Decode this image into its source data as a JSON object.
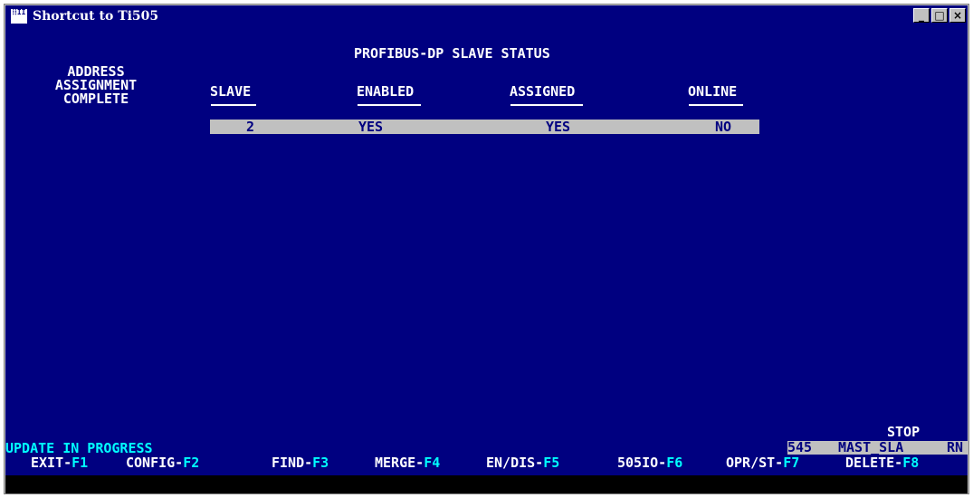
{
  "window": {
    "title": "Shortcut to Ti505",
    "icon_text": "⁞⁞ΙΙ",
    "minimize": "_",
    "maximize": "□",
    "close": "×"
  },
  "screen": {
    "heading": "PROFIBUS-DP SLAVE STATUS",
    "address_label": [
      "ADDRESS",
      "ASSIGNMENT",
      "COMPLETE"
    ],
    "columns": [
      "SLAVE",
      "ENABLED",
      "ASSIGNED",
      "ONLINE"
    ],
    "rows": [
      {
        "slave": "2",
        "enabled": "YES",
        "assigned": "YES",
        "online": "NO"
      }
    ],
    "status_message": "UPDATE IN PROGRESS",
    "mode": "STOP",
    "plc_model": "545",
    "program_name": "MAST_SLA",
    "run_indicator": "RN"
  },
  "function_keys": [
    {
      "label": "EXIT-",
      "key": "F1"
    },
    {
      "label": "CONFIG-",
      "key": "F2"
    },
    {
      "label": "FIND-",
      "key": "F3"
    },
    {
      "label": "MERGE-",
      "key": "F4"
    },
    {
      "label": "EN/DIS-",
      "key": "F5"
    },
    {
      "label": "505IO-",
      "key": "F6"
    },
    {
      "label": "OPR/ST-",
      "key": "F7"
    },
    {
      "label": "DELETE-",
      "key": "F8"
    }
  ],
  "colors": {
    "screen_bg": "#000080",
    "highlight": "#c0c0c0",
    "key_color": "#00ffff",
    "text": "#ffffff"
  }
}
